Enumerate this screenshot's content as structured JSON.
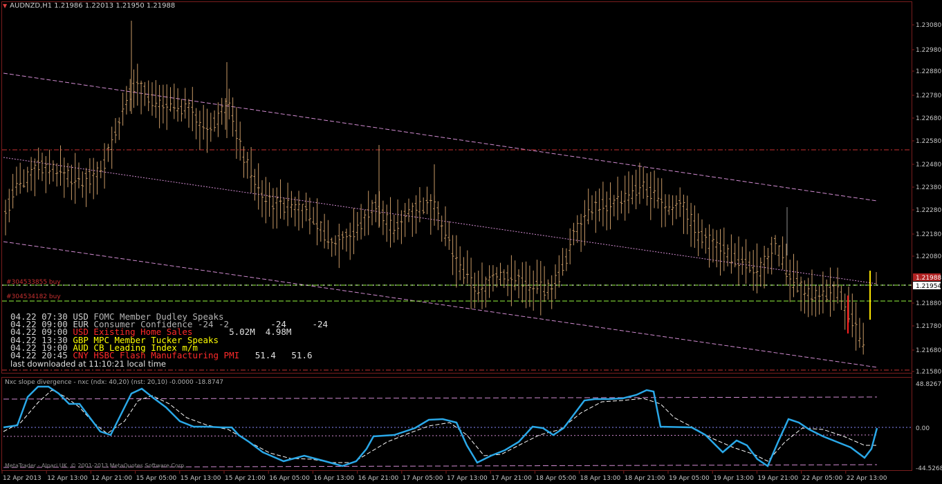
{
  "window": {
    "symbol_title": "AUDNZD,H1  1.21986 1.22013 1.21950 1.21988"
  },
  "price_axis": {
    "labels": [
      "1.23080",
      "1.22980",
      "1.22880",
      "1.22780",
      "1.22680",
      "1.22580",
      "1.22480",
      "1.22380",
      "1.22280",
      "1.22180",
      "1.22080",
      "1.21880",
      "1.21780",
      "1.21680",
      "1.21580"
    ],
    "current_price": "1.21988",
    "bid_line_price": "1.21954"
  },
  "orders": [
    {
      "label": "#304533855 buy",
      "color": "#c83030"
    },
    {
      "label": "#304534182 buy",
      "color": "#c83030"
    }
  ],
  "news": {
    "items": [
      {
        "time": "04.22 07:30",
        "currency": "USD",
        "event": "FOMC Member Dudley Speaks",
        "values": "",
        "color": "#b4b4b4"
      },
      {
        "time": "04.22 09:00",
        "currency": "EUR",
        "event": "Consumer Confidence -24 -2",
        "values": "        -24     -24",
        "color": "#b4b4b4"
      },
      {
        "time": "04.22 09:00",
        "currency": "USD",
        "event": "Existing Home Sales",
        "values": "       5.02M  4.98M",
        "color": "#ff2a2a"
      },
      {
        "time": "04.22 13:30",
        "currency": "GBP",
        "event": "MPC Member Tucker Speaks",
        "values": "",
        "color": "#ffff00"
      },
      {
        "time": "04.22 19:00",
        "currency": "AUD",
        "event": "CB Leading Index m/m",
        "values": "",
        "color": "#ffff00"
      },
      {
        "time": "04.22 20:45",
        "currency": "CNY",
        "event": "HSBC Flash Manufacturing PMI",
        "values": "   51.4   51.6",
        "color": "#ff2a2a"
      }
    ],
    "last_downloaded": "last downloaded at 11:10:21 local time"
  },
  "indicator": {
    "title": "Nxc slope divergence - nxc (ndx: 40,20) (nst: 20,10) -0.0000 -18.8747",
    "axis_labels": [
      "48.8267",
      "0.00",
      "-44.5268"
    ]
  },
  "copyright": "MetaTrader - Alpari UK, © 2001-2013 MetaQuotes Software Corp.",
  "time_axis": {
    "labels": [
      "12 Apr 2013",
      "12 Apr 13:00",
      "12 Apr 21:00",
      "15 Apr 05:00",
      "15 Apr 13:00",
      "15 Apr 21:00",
      "16 Apr 05:00",
      "16 Apr 13:00",
      "16 Apr 21:00",
      "17 Apr 05:00",
      "17 Apr 13:00",
      "17 Apr 21:00",
      "18 Apr 05:00",
      "18 Apr 13:00",
      "18 Apr 21:00",
      "19 Apr 05:00",
      "19 Apr 13:00",
      "19 Apr 21:00",
      "22 Apr 05:00",
      "22 Apr 13:00"
    ]
  },
  "colors": {
    "background": "#000000",
    "frame": "#7a1e1e",
    "bar": "#c89a66",
    "channel": "#d28cd2",
    "resistance": "#c83030",
    "order_line": "#78c832",
    "fast_line": "#2aa8e8",
    "slow_line": "#ffffff",
    "up_bar": "#ffe600",
    "down_bar": "#ff2020"
  }
}
